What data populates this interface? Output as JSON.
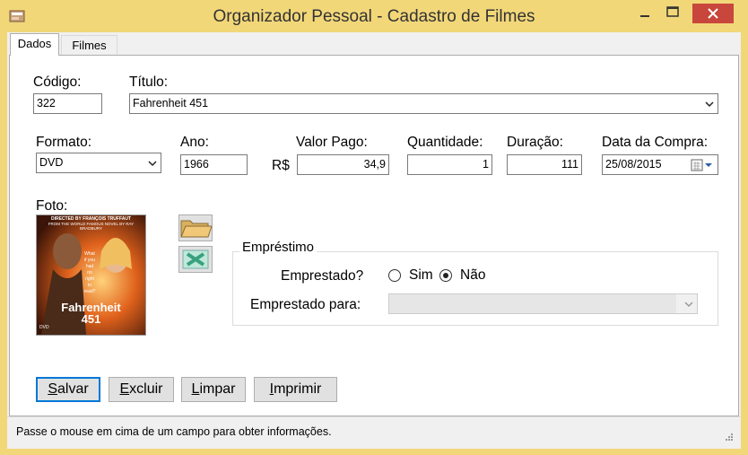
{
  "window": {
    "title": "Organizador Pessoal - Cadastro de Filmes"
  },
  "tabs": [
    {
      "label": "Dados",
      "selected": true
    },
    {
      "label": "Filmes",
      "selected": false
    }
  ],
  "form": {
    "codigo_label": "Código:",
    "codigo_value": "322",
    "titulo_label": "Título:",
    "titulo_value": "Fahrenheit 451",
    "formato_label": "Formato:",
    "formato_value": "DVD",
    "ano_label": "Ano:",
    "ano_value": "1966",
    "valor_label": "Valor Pago:",
    "currency": "R$",
    "valor_value": "34,9",
    "quantidade_label": "Quantidade:",
    "quantidade_value": "1",
    "duracao_label": "Duração:",
    "duracao_value": "111",
    "data_label": "Data da Compra:",
    "data_value": "25/08/2015",
    "foto_label": "Foto:"
  },
  "poster": {
    "top_line1": "DIRECTED BY FRANÇOIS TRUFFAUT",
    "top_line2": "FROM THE WORLD FAMOUS NOVEL BY RAY BRADBURY",
    "tagline": "What if you had no right to read?",
    "title_line1": "Fahrenheit",
    "title_line2": "451",
    "badge": "DVD"
  },
  "emprestimo": {
    "group_title": "Empréstimo",
    "emprestado_label": "Emprestado?",
    "sim_label": "Sim",
    "nao_label": "Não",
    "selected": "Não",
    "para_label": "Emprestado para:",
    "para_value": ""
  },
  "buttons": {
    "salvar_pre": "",
    "salvar_key": "S",
    "salvar_post": "alvar",
    "excluir_pre": "",
    "excluir_key": "E",
    "excluir_post": "xcluir",
    "limpar_pre": "",
    "limpar_key": "L",
    "limpar_post": "impar",
    "imprimir_pre": "",
    "imprimir_key": "I",
    "imprimir_post": "mprimir"
  },
  "status": {
    "text": "Passe o mouse em cima de um campo para obter informações."
  },
  "colors": {
    "titlebar": "#f2d779",
    "close": "#c9463d",
    "accent": "#0078d7"
  }
}
